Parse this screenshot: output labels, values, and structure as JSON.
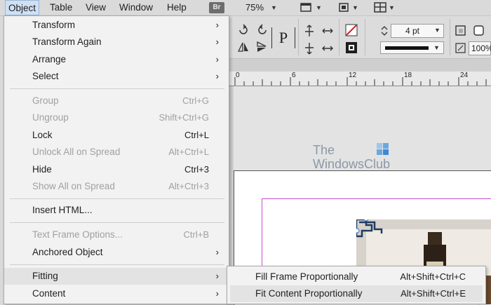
{
  "menubar": {
    "items": [
      "Object",
      "Table",
      "View",
      "Window",
      "Help"
    ],
    "bridge_badge": "Br",
    "zoom": "75%"
  },
  "control_panel": {
    "stroke_weight": "4 pt",
    "scale": "100%"
  },
  "ruler": {
    "labels": [
      "0",
      "6",
      "12",
      "18",
      "24"
    ]
  },
  "watermark": {
    "line1": "The",
    "line2": "WindowsClub"
  },
  "object_menu": {
    "items": [
      {
        "label": "Transform",
        "shortcut": "",
        "submenu": true,
        "disabled": false
      },
      {
        "label": "Transform Again",
        "shortcut": "",
        "submenu": true,
        "disabled": false
      },
      {
        "label": "Arrange",
        "shortcut": "",
        "submenu": true,
        "disabled": false
      },
      {
        "label": "Select",
        "shortcut": "",
        "submenu": true,
        "disabled": false
      },
      {
        "label": "Group",
        "shortcut": "Ctrl+G",
        "submenu": false,
        "disabled": true
      },
      {
        "label": "Ungroup",
        "shortcut": "Shift+Ctrl+G",
        "submenu": false,
        "disabled": true
      },
      {
        "label": "Lock",
        "shortcut": "Ctrl+L",
        "submenu": false,
        "disabled": false
      },
      {
        "label": "Unlock All on Spread",
        "shortcut": "Alt+Ctrl+L",
        "submenu": false,
        "disabled": true
      },
      {
        "label": "Hide",
        "shortcut": "Ctrl+3",
        "submenu": false,
        "disabled": false
      },
      {
        "label": "Show All on Spread",
        "shortcut": "Alt+Ctrl+3",
        "submenu": false,
        "disabled": true
      },
      {
        "label": "Insert HTML...",
        "shortcut": "",
        "submenu": false,
        "disabled": false
      },
      {
        "label": "Text Frame Options...",
        "shortcut": "Ctrl+B",
        "submenu": false,
        "disabled": true
      },
      {
        "label": "Anchored Object",
        "shortcut": "",
        "submenu": true,
        "disabled": false
      },
      {
        "label": "Fitting",
        "shortcut": "",
        "submenu": true,
        "disabled": false
      },
      {
        "label": "Content",
        "shortcut": "",
        "submenu": true,
        "disabled": false
      }
    ]
  },
  "fitting_submenu": {
    "items": [
      {
        "label": "Fill Frame Proportionally",
        "shortcut": "Alt+Shift+Ctrl+C"
      },
      {
        "label": "Fit Content Proportionally",
        "shortcut": "Alt+Shift+Ctrl+E"
      }
    ]
  }
}
